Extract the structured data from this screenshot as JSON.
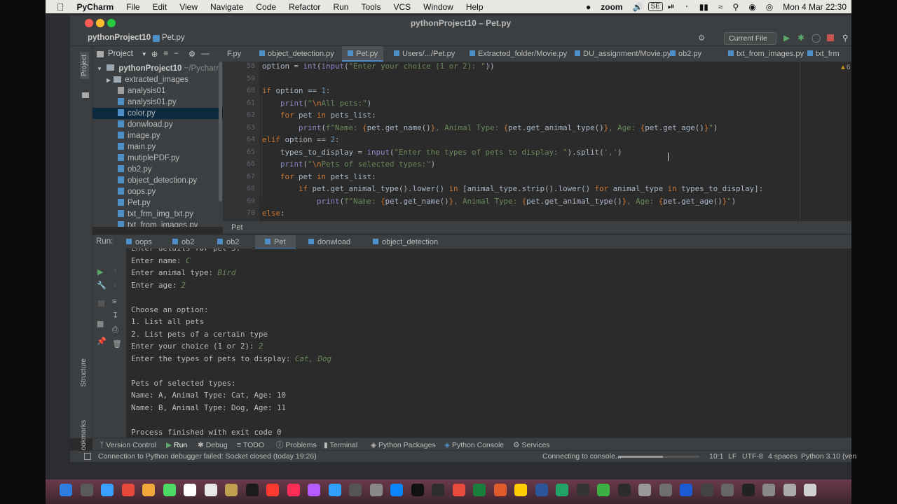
{
  "menubar": {
    "app_name": "PyCharm",
    "items": [
      "File",
      "Edit",
      "View",
      "Navigate",
      "Code",
      "Refactor",
      "Run",
      "Tools",
      "VCS",
      "Window",
      "Help"
    ],
    "zoom_label": "zoom",
    "input_source": "SE",
    "clock": "Mon 4 Mar  22:30"
  },
  "window": {
    "title": "pythonProject10 – Pet.py",
    "project_name": "pythonProject10",
    "current_file": "Pet.py",
    "run_config": "Current File"
  },
  "project_panel": {
    "header": "Project",
    "root": "pythonProject10",
    "root_path": "~/PycharmP",
    "items": [
      {
        "label": "extracted_images",
        "kind": "folder"
      },
      {
        "label": "analysis01",
        "kind": "file"
      },
      {
        "label": "analysis01.py",
        "kind": "py"
      },
      {
        "label": "color.py",
        "kind": "py",
        "selected": true
      },
      {
        "label": "donwload.py",
        "kind": "py"
      },
      {
        "label": "image.py",
        "kind": "py"
      },
      {
        "label": "main.py",
        "kind": "py"
      },
      {
        "label": "mutiplePDF.py",
        "kind": "py"
      },
      {
        "label": "ob2.py",
        "kind": "py"
      },
      {
        "label": "object_detection.py",
        "kind": "py"
      },
      {
        "label": "oops.py",
        "kind": "py"
      },
      {
        "label": "Pet.py",
        "kind": "py"
      },
      {
        "label": "txt_frm_img_txt.py",
        "kind": "py"
      },
      {
        "label": "txt_from_images.py",
        "kind": "py"
      }
    ]
  },
  "editor_tabs": [
    "F.py",
    "object_detection.py",
    "Pet.py",
    "Users/.../Pet.py",
    "Extracted_folder/Movie.py",
    "DU_assignment/Movie.py",
    "ob2.py",
    "txt_from_images.py",
    "txt_frm"
  ],
  "inspection_count": "6",
  "code": {
    "line_numbers": [
      "58",
      "59",
      "60",
      "61",
      "62",
      "63",
      "64",
      "65",
      "66",
      "67",
      "68",
      "69",
      "70"
    ],
    "breadcrumb": "Pet"
  },
  "run_panel": {
    "label": "Run:",
    "tabs": [
      "oops",
      "ob2",
      "ob2",
      "Pet",
      "donwload",
      "object_detection"
    ],
    "active_tab": "Pet"
  },
  "console": {
    "lines": [
      {
        "text": "Enter details for pet 3:",
        "input": ""
      },
      {
        "text": "Enter name: ",
        "input": "C"
      },
      {
        "text": "Enter animal type: ",
        "input": "Bird"
      },
      {
        "text": "Enter age: ",
        "input": "2"
      },
      {
        "text": "",
        "input": ""
      },
      {
        "text": "Choose an option:",
        "input": ""
      },
      {
        "text": "1. List all pets",
        "input": ""
      },
      {
        "text": "2. List pets of a certain type",
        "input": ""
      },
      {
        "text": "Enter your choice (1 or 2): ",
        "input": "2"
      },
      {
        "text": "Enter the types of pets to display: ",
        "input": "Cat, Dog"
      },
      {
        "text": "",
        "input": ""
      },
      {
        "text": "Pets of selected types:",
        "input": ""
      },
      {
        "text": "Name: A, Animal Type: Cat, Age: 10",
        "input": ""
      },
      {
        "text": "Name: B, Animal Type: Dog, Age: 11",
        "input": ""
      },
      {
        "text": "",
        "input": ""
      },
      {
        "text": "Process finished with exit code 0",
        "input": ""
      }
    ]
  },
  "left_strip": {
    "project": "Project",
    "structure": "Structure",
    "bookmarks": "Bookmarks"
  },
  "bottom_tools": [
    "Version Control",
    "Run",
    "Debug",
    "TODO",
    "Problems",
    "Terminal",
    "Python Packages",
    "Python Console",
    "Services"
  ],
  "status": {
    "message": "Connection to Python debugger failed: Socket closed (today 19:26)",
    "progress_label": "Connecting to console...",
    "position": "10:1",
    "line_ending": "LF",
    "encoding": "UTF-8",
    "indent": "4 spaces",
    "interpreter": "Python 3.10 (ven"
  }
}
